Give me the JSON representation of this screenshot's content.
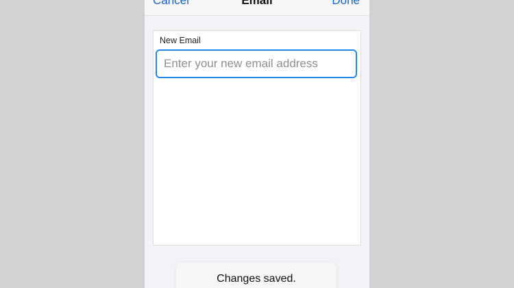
{
  "navbar": {
    "cancel_label": "Cancel",
    "title": "Email",
    "done_label": "Done"
  },
  "form": {
    "field_label": "New Email",
    "email_value": "",
    "email_placeholder": "Enter your new email address"
  },
  "toast": {
    "message": "Changes saved."
  },
  "colors": {
    "accent": "#1a63c9",
    "focus_border": "#1f86f0",
    "backdrop": "#d3d1d3",
    "screen_background": "#f2f2f7"
  }
}
